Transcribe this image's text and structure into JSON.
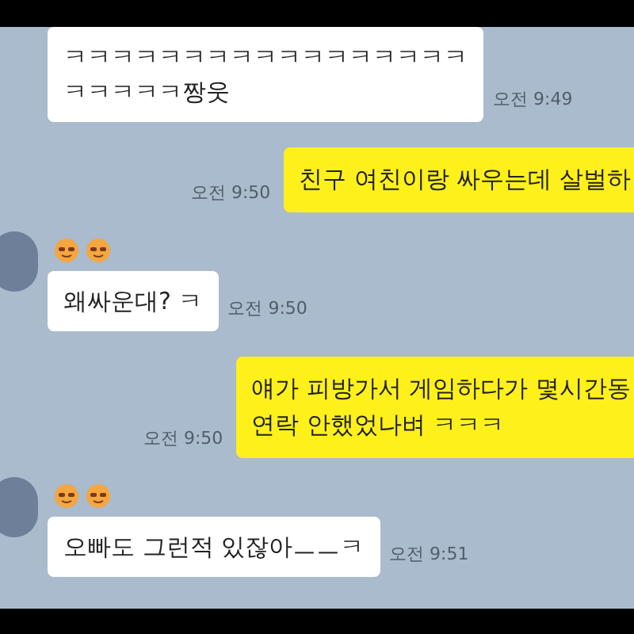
{
  "messages": [
    {
      "kind": "received",
      "avatar": false,
      "lines": [
        "ㅋㅋㅋㅋㅋㅋㅋㅋㅋㅋㅋㅋㅋㅋㅋㅋㅋ",
        "ㅋㅋㅋㅋㅋ짱웃"
      ],
      "time": "오전 9:49"
    },
    {
      "kind": "sent",
      "lines": [
        "친구 여친이랑 싸우는데 살벌하"
      ],
      "time": "오전 9:50"
    },
    {
      "kind": "received",
      "avatar": true,
      "lines": [
        "왜싸운대? ㅋ"
      ],
      "time": "오전 9:50"
    },
    {
      "kind": "sent",
      "lines": [
        "얘가 피방가서 게임하다가 몇시간동",
        "연락 안했었나벼 ㅋㅋㅋ"
      ],
      "time": "오전 9:50"
    },
    {
      "kind": "received",
      "avatar": true,
      "lines": [
        "오빠도 그런적 있잖아ㅡㅡㅋ"
      ],
      "time": "오전 9:51"
    }
  ]
}
